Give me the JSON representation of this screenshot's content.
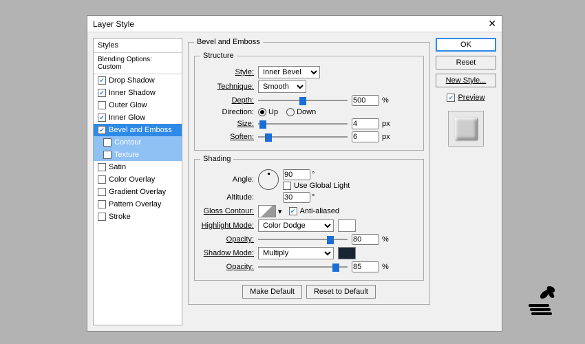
{
  "window": {
    "title": "Layer Style"
  },
  "styles_panel": {
    "header": "Styles",
    "subheader": "Blending Options: Custom",
    "items": [
      {
        "label": "Drop Shadow",
        "checked": true
      },
      {
        "label": "Inner Shadow",
        "checked": true
      },
      {
        "label": "Outer Glow",
        "checked": false
      },
      {
        "label": "Inner Glow",
        "checked": true
      },
      {
        "label": "Bevel and Emboss",
        "checked": true,
        "selected": true
      },
      {
        "label": "Contour",
        "checked": false,
        "sub": true
      },
      {
        "label": "Texture",
        "checked": false,
        "sub": true
      },
      {
        "label": "Satin",
        "checked": false
      },
      {
        "label": "Color Overlay",
        "checked": false
      },
      {
        "label": "Gradient Overlay",
        "checked": false
      },
      {
        "label": "Pattern Overlay",
        "checked": false
      },
      {
        "label": "Stroke",
        "checked": false
      }
    ]
  },
  "bevel": {
    "title": "Bevel and Emboss",
    "structure_title": "Structure",
    "style_label": "Style:",
    "style_value": "Inner Bevel",
    "technique_label": "Technique:",
    "technique_value": "Smooth",
    "depth_label": "Depth:",
    "depth_value": "500",
    "depth_unit": "%",
    "direction_label": "Direction:",
    "dir_up": "Up",
    "dir_down": "Down",
    "size_label": "Size:",
    "size_value": "4",
    "size_unit": "px",
    "soften_label": "Soften:",
    "soften_value": "6",
    "soften_unit": "px",
    "shading_title": "Shading",
    "angle_label": "Angle:",
    "angle_value": "90",
    "angle_unit": "°",
    "global_light": "Use Global Light",
    "altitude_label": "Altitude:",
    "altitude_value": "30",
    "altitude_unit": "°",
    "gloss_label": "Gloss Contour:",
    "antialiased": "Anti-aliased",
    "highlight_label": "Highlight Mode:",
    "highlight_value": "Color Dodge",
    "highlight_opacity_label": "Opacity:",
    "highlight_opacity": "80",
    "shadow_label": "Shadow Mode:",
    "shadow_value": "Multiply",
    "shadow_opacity_label": "Opacity:",
    "shadow_opacity": "85",
    "pct": "%",
    "make_default": "Make Default",
    "reset_default": "Reset to Default"
  },
  "right": {
    "ok": "OK",
    "reset": "Reset",
    "new_style": "New Style...",
    "preview": "Preview"
  },
  "colors": {
    "highlight": "#ffffff",
    "shadow": "#1a2533"
  }
}
